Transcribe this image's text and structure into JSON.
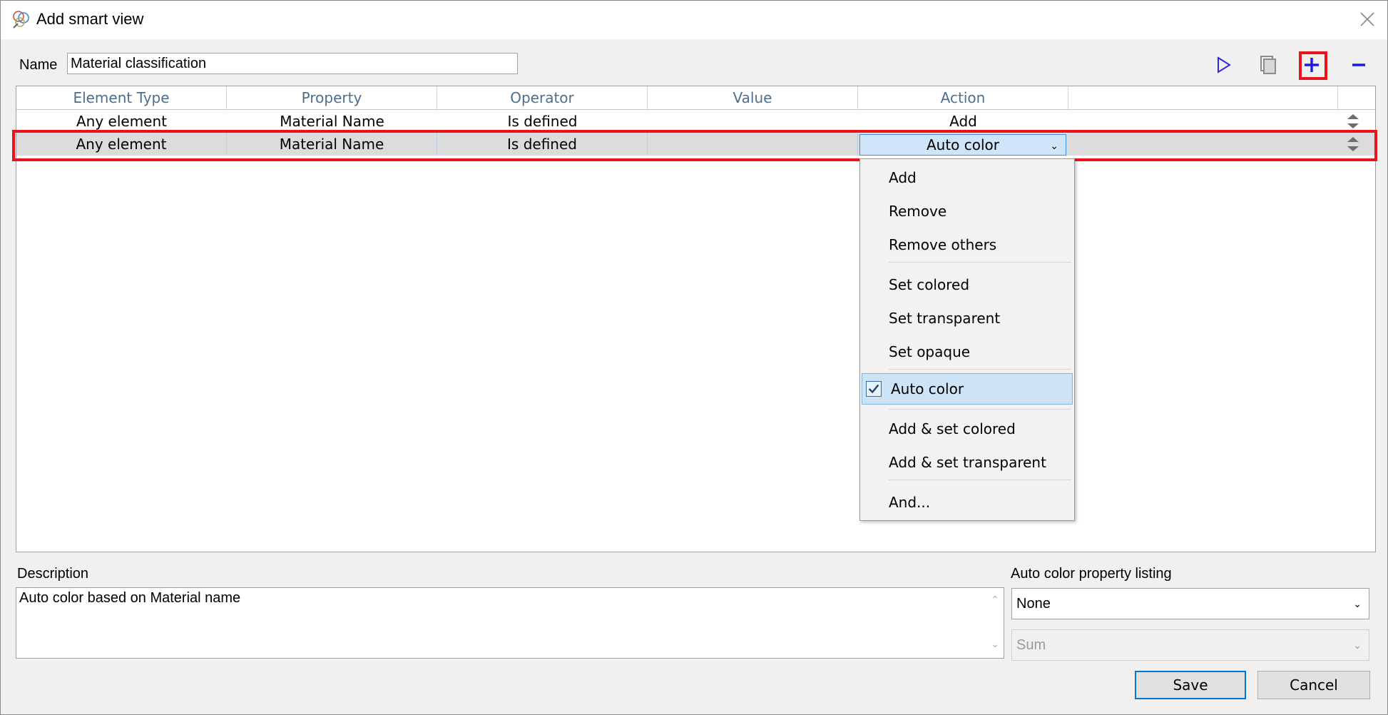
{
  "window": {
    "title": "Add smart view"
  },
  "name_field": {
    "label": "Name",
    "value": "Material classification"
  },
  "toolbar": {
    "run_icon": "play-icon",
    "copy_icon": "copy-icon",
    "add_icon": "plus-icon",
    "remove_icon": "minus-icon",
    "accent_color": "#1a1ae6",
    "highlight_color": "#e8141c"
  },
  "grid": {
    "columns": [
      "Element Type",
      "Property",
      "Operator",
      "Value",
      "Action",
      ""
    ],
    "rows": [
      {
        "element_type": "Any element",
        "property": "Material Name",
        "operator": "Is defined",
        "value": "",
        "action": "Add"
      },
      {
        "element_type": "Any element",
        "property": "Material Name",
        "operator": "Is defined",
        "value": "",
        "action": "Auto color"
      }
    ]
  },
  "action_dropdown": {
    "selected": "Auto color",
    "options": [
      "Add",
      "Remove",
      "Remove others",
      "Set colored",
      "Set transparent",
      "Set opaque",
      "Auto color",
      "Add & set colored",
      "Add & set transparent",
      "And..."
    ]
  },
  "description": {
    "label": "Description",
    "value": "Auto color based on Material name"
  },
  "auto_color": {
    "label": "Auto color property listing",
    "listing_value": "None",
    "aggregate_value": "Sum"
  },
  "buttons": {
    "save": "Save",
    "cancel": "Cancel"
  }
}
